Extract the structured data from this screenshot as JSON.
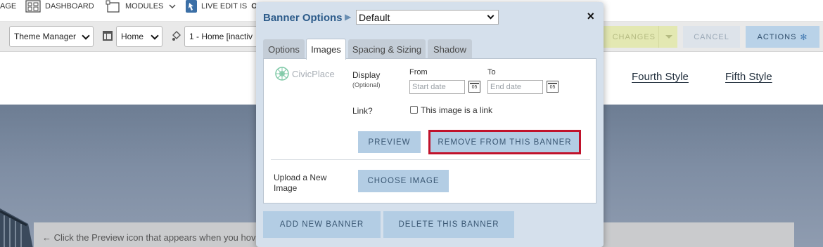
{
  "topbar": {
    "page_label": "AGE",
    "dashboard_label": "DASHBOARD",
    "modules_label": "MODULES",
    "live_edit_label": "LIVE EDIT IS",
    "live_edit_state": "ON"
  },
  "toolbar": {
    "theme_select_value": "Theme Manager",
    "home_select_value": "Home",
    "page_select_value": "1 - Home [inactiv",
    "changes_label": "CHANGES",
    "cancel_label": "CANCEL",
    "actions_label": "ACTIONS"
  },
  "site": {
    "nav": [
      "Fourth Style",
      "Fifth Style"
    ],
    "preview_hint": "← Click the Preview icon that appears when you hov"
  },
  "modal": {
    "title": "Banner Options",
    "arrow": "▶",
    "banner_select_value": "Default",
    "close_label": "×",
    "tabs": [
      "Options",
      "Images",
      "Spacing & Sizing",
      "Shadow"
    ],
    "active_tab": "Images",
    "logo_text": "CivicPlace",
    "display_label": "Display",
    "optional_label": "(Optional)",
    "from_label": "From",
    "to_label": "To",
    "start_placeholder": "Start date",
    "end_placeholder": "End date",
    "calendar_day": "05",
    "link_label": "Link?",
    "link_checkbox_label": "This image is a link",
    "link_checked": false,
    "preview_button": "PREVIEW",
    "remove_button": "REMOVE FROM THIS BANNER",
    "upload_label": "Upload a New Image",
    "choose_button": "CHOOSE IMAGE",
    "add_banner_button": "ADD NEW BANNER",
    "delete_banner_button": "DELETE THIS BANNER"
  },
  "colors": {
    "modal_bg": "#d5e0ec",
    "title_blue": "#2c5b8a",
    "button_blue": "#b3cde4",
    "highlight_red": "#c0122b",
    "changes_green": "#e3e8b2"
  }
}
